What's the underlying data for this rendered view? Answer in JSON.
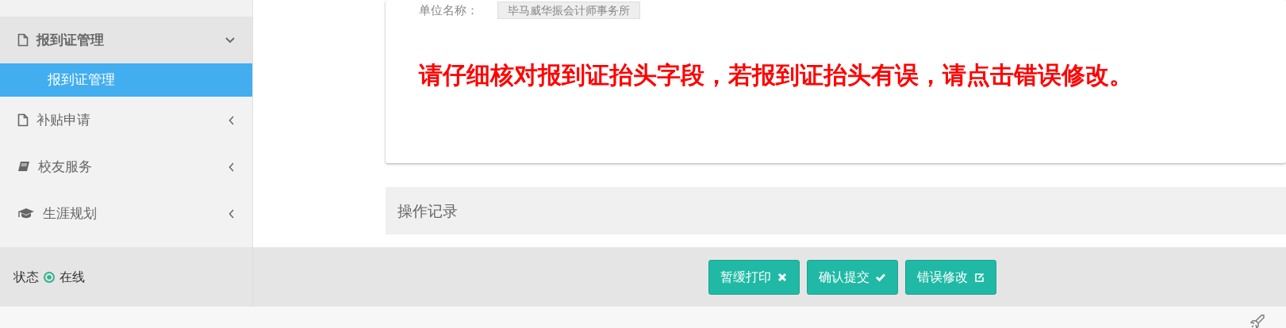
{
  "sidebar": {
    "items": [
      {
        "label": "报到证管理",
        "expanded": true,
        "children": [
          {
            "label": "报到证管理",
            "selected": true
          }
        ]
      },
      {
        "label": "补贴申请",
        "expanded": false
      },
      {
        "label": "校友服务",
        "expanded": false
      },
      {
        "label": "生涯规划",
        "expanded": false
      }
    ],
    "status": {
      "label": "状态",
      "value": "在线",
      "online": true
    }
  },
  "form": {
    "fields": [
      {
        "label": "单位名称：",
        "value": "毕马威华振会计师事务所"
      }
    ],
    "notice": "请仔细核对报到证抬头字段，若报到证抬头有误，请点击错误修改。"
  },
  "log_panel": {
    "title": "操作记录"
  },
  "actions": [
    {
      "label": "暂缓打印"
    },
    {
      "label": "确认提交"
    },
    {
      "label": "错误修改"
    }
  ]
}
